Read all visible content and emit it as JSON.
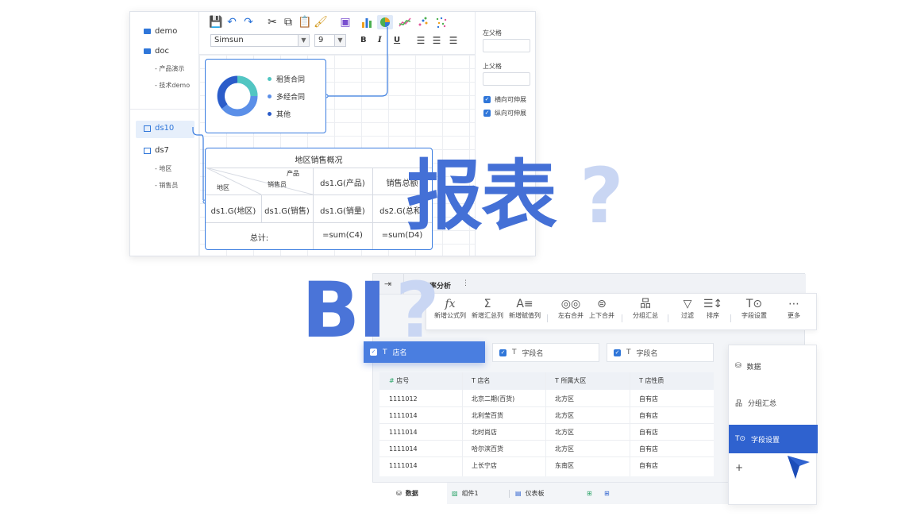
{
  "report": {
    "tree": {
      "demo": "demo",
      "doc": "doc",
      "doc_children": [
        "- 产品演示",
        "- 技术demo"
      ],
      "ds10": "ds10",
      "ds7": "ds7",
      "ds7_children": [
        "- 地区",
        "- 销售员"
      ]
    },
    "toolbar": {
      "font": "Simsun",
      "size": "9",
      "bold": "B",
      "italic": "I",
      "underline": "U"
    },
    "right_panel": {
      "left_parent": "左父格",
      "top_parent": "上父格",
      "expand_h": "横向可伸展",
      "expand_v": "纵向可伸展"
    },
    "chart_legend": [
      "租赁合同",
      "多经合同",
      "其他"
    ],
    "table": {
      "title": "地区销售概况",
      "diag_product": "产品",
      "diag_seller": "销售员",
      "diag_region": "地区",
      "h_product": "ds1.G(产品)",
      "h_total": "销售总额",
      "r_region": "ds1.G(地区)",
      "r_sales": "ds1.G(销售)",
      "r_qty": "ds1.G(销量)",
      "r_sum": "ds2.G(总和)",
      "f_total": "总计:",
      "f_c4": "=sum(C4)",
      "f_d4": "=sum(D4)"
    }
  },
  "overlay": {
    "baobiao": "报表",
    "q": "?",
    "bi": "BI"
  },
  "bi": {
    "tab_title": "转换率分析",
    "more": "⋮",
    "tools": [
      {
        "icon": "fx",
        "label": "新增公式列"
      },
      {
        "icon": "Σ",
        "label": "新增汇总列"
      },
      {
        "icon": "A≡",
        "label": "新增赋值列"
      },
      {
        "icon": "◎◎",
        "label": "左右合并"
      },
      {
        "icon": "⊜",
        "label": "上下合并"
      },
      {
        "icon": "品",
        "label": "分组汇总"
      },
      {
        "icon": "▽",
        "label": "过滤"
      },
      {
        "icon": "☰↕",
        "label": "排序"
      },
      {
        "icon": "T⊙",
        "label": "字段设置"
      },
      {
        "icon": "⋯",
        "label": "更多"
      }
    ],
    "chips": [
      "店名",
      "字段名",
      "字段名"
    ],
    "columns": [
      "店号",
      "店名",
      "所属大区",
      "店性质"
    ],
    "rows": [
      [
        "1111012",
        "北京二期(百货)",
        "北方区",
        "自有店"
      ],
      [
        "1111014",
        "北利莹百货",
        "北方区",
        "自有店"
      ],
      [
        "1111014",
        "北时尚店",
        "北方区",
        "自有店"
      ],
      [
        "1111014",
        "哈尔滨百货",
        "北方区",
        "自有店"
      ],
      [
        "1111014",
        "上长宁店",
        "东南区",
        "自有店"
      ]
    ],
    "bottom_tabs": [
      "数据",
      "组件1",
      "仪表板"
    ],
    "menu": [
      "数据",
      "分组汇总",
      "字段设置",
      "+"
    ],
    "colors": {
      "accent": "#2f62cf",
      "chip": "#4a7ee0"
    }
  }
}
